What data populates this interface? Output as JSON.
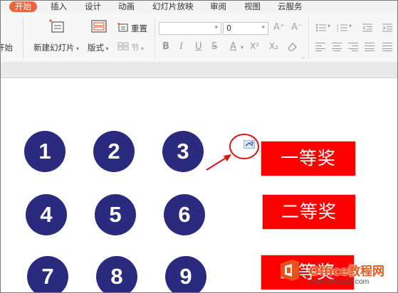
{
  "menu_tabs": [
    "开始",
    "插入",
    "设计",
    "动画",
    "幻灯片放映",
    "审阅",
    "视图",
    "云服务"
  ],
  "ribbon": {
    "left_cut_label": "开始",
    "new_slide_label": "新建幻灯片",
    "layout_label": "版式",
    "reset_label": "重置",
    "section_label": "节",
    "font_name_value": "",
    "font_size_value": "0",
    "grow_font": "A⁺",
    "shrink_font": "A⁻",
    "format_buttons": {
      "bold": "B",
      "italic": "I",
      "underline": "U",
      "strike": "S",
      "color": "A",
      "superscript": "X²",
      "subscript": "X₂"
    }
  },
  "slide": {
    "numbers": [
      "1",
      "2",
      "3",
      "4",
      "5",
      "6",
      "7",
      "8",
      "9"
    ],
    "prizes": [
      "一等奖",
      "二等奖",
      "三等奖"
    ]
  },
  "watermark": {
    "title": "Office教程网",
    "url": "www.office26.com"
  },
  "colors": {
    "active_tab": "#e8663d",
    "circle": "#2a2a7e",
    "prize_box": "#ff0000",
    "annotation": "#e01010"
  }
}
